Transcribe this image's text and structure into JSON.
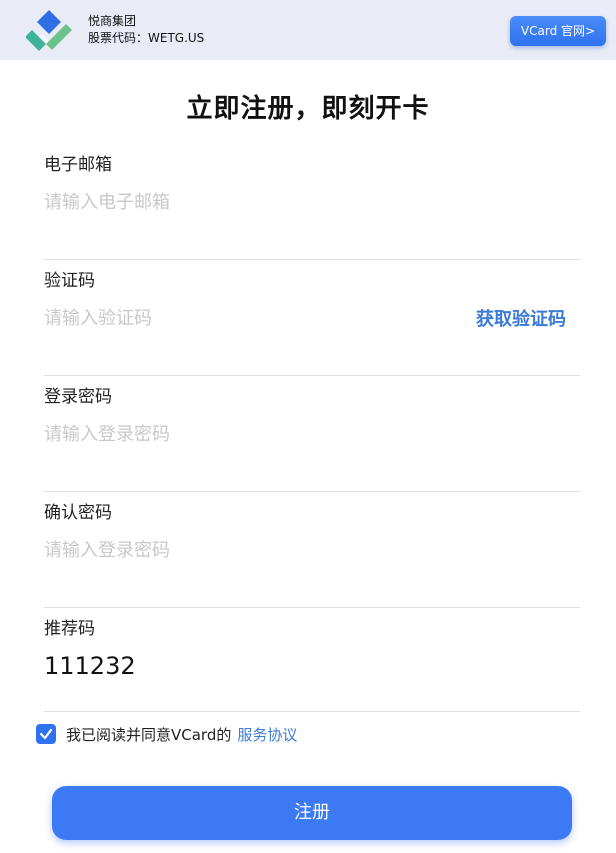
{
  "header": {
    "company_name": "悦商集团",
    "stock_code": "股票代码：WETG.US",
    "vcard_button": "VCard 官网>",
    "colors": {
      "logo_blue": "#2f6fe6",
      "logo_teal": "#3fb39a",
      "logo_green": "#6cc38a"
    }
  },
  "title": "立即注册，即刻开卡",
  "form": {
    "email": {
      "label": "电子邮箱",
      "placeholder": "请输入电子邮箱",
      "value": ""
    },
    "code": {
      "label": "验证码",
      "placeholder": "请输入验证码",
      "value": "",
      "get_code_label": "获取验证码"
    },
    "password": {
      "label": "登录密码",
      "placeholder": "请输入登录密码",
      "value": ""
    },
    "confirm_password": {
      "label": "确认密码",
      "placeholder": "请输入登录密码",
      "value": ""
    },
    "referral": {
      "label": "推荐码",
      "placeholder": "",
      "value": "111232"
    }
  },
  "agreement": {
    "checked": true,
    "text": "我已阅读并同意VCard的",
    "link": "服务协议"
  },
  "register_button": "注册",
  "colors": {
    "accent": "#3c7af5",
    "link": "#3a7bd8"
  }
}
